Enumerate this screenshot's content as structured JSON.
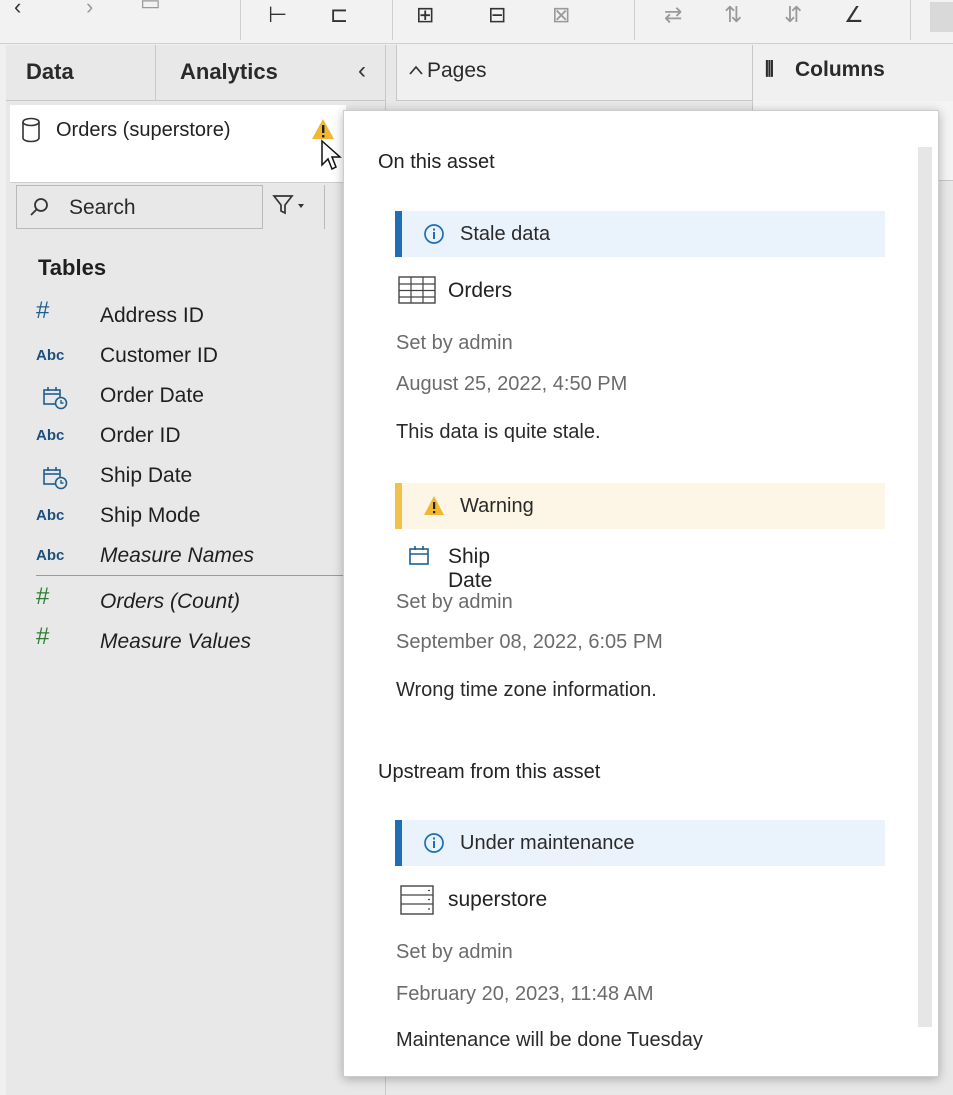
{
  "colors": {
    "info_accent": "#1f6eb5",
    "info_bg": "#eaf2fb",
    "warning_accent": "#f2c14a",
    "warning_bg": "#fdf6e6",
    "measure_green": "#2e7d32",
    "dimension_blue": "#1e5f8e"
  },
  "data_pane": {
    "tabs": [
      {
        "label": "Data"
      },
      {
        "label": "Analytics"
      }
    ],
    "datasource": {
      "name": "Orders (superstore)",
      "icon": "database-icon",
      "status_icon": "warning-icon"
    },
    "search": {
      "label": "Search"
    },
    "tables_heading": "Tables",
    "fields": [
      {
        "type": "number",
        "icon": "hash-icon",
        "name": "Address ID"
      },
      {
        "type": "string",
        "icon": "abc-icon",
        "icon_text": "Abc",
        "name": "Customer ID"
      },
      {
        "type": "datetime",
        "icon": "calendar-clock-icon",
        "name": "Order Date"
      },
      {
        "type": "string",
        "icon": "abc-icon",
        "icon_text": "Abc",
        "name": "Order ID"
      },
      {
        "type": "datetime",
        "icon": "calendar-clock-icon",
        "name": "Ship Date"
      },
      {
        "type": "string",
        "icon": "abc-icon",
        "icon_text": "Abc",
        "name": "Ship Mode"
      },
      {
        "type": "string",
        "icon": "abc-icon",
        "icon_text": "Abc",
        "name": "Measure Names"
      }
    ],
    "measures": [
      {
        "icon": "hash-icon",
        "name": "Orders (Count)"
      },
      {
        "icon": "hash-icon",
        "name": "Measure Values"
      }
    ]
  },
  "shelves": {
    "pages_label": "Pages",
    "columns_label": "Columns"
  },
  "popup": {
    "on_asset_heading": "On this asset",
    "upstream_heading": "Upstream from this asset",
    "warnings": [
      {
        "kind": "info",
        "banner": "Stale data",
        "asset_icon": "table-icon",
        "asset": "Orders",
        "set_by": "Set by admin",
        "date": "August 25, 2022, 4:50 PM",
        "message": "This data is quite stale."
      },
      {
        "kind": "warning",
        "banner": "Warning",
        "asset_icon": "calendar-icon",
        "asset": "Ship Date",
        "set_by": "Set by admin",
        "date": "September 08, 2022, 6:05 PM",
        "message": "Wrong time zone information."
      }
    ],
    "upstream": [
      {
        "kind": "info",
        "banner": "Under maintenance",
        "asset_icon": "database-table-icon",
        "asset": "superstore",
        "set_by": "Set by admin",
        "date": "February 20, 2023, 11:48 AM",
        "message": "Maintenance will be done Tuesday"
      }
    ]
  }
}
